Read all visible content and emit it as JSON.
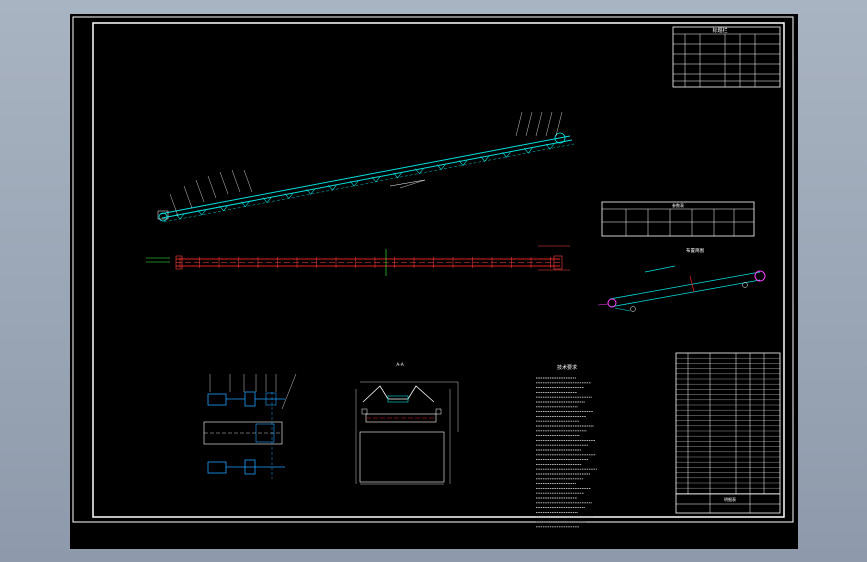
{
  "viewport": {
    "background": "#000000",
    "frame_color": "#ffffff"
  },
  "colors": {
    "conveyor": "#00e0e0",
    "plan_view": "#e02020",
    "plan_dash": "#ff4040",
    "highlight": "#ff40ff",
    "drive": "#20a0ff",
    "label": "#ffffff",
    "dim": "#d0d0d0"
  },
  "tables": {
    "title_block_heading": "标题栏",
    "parameter_table_heading": "参数表",
    "parameter_row_label_1": "",
    "parameter_row_label_2": "",
    "parts_list_heading": "明细表"
  },
  "notes": {
    "heading": "技术要求"
  },
  "views": {
    "layout_diagram_caption": "布置简图",
    "section_caption": "A-A"
  },
  "icons": [
    "leader-callout-icon",
    "roller-idler-icon",
    "pulley-icon",
    "motor-icon"
  ]
}
